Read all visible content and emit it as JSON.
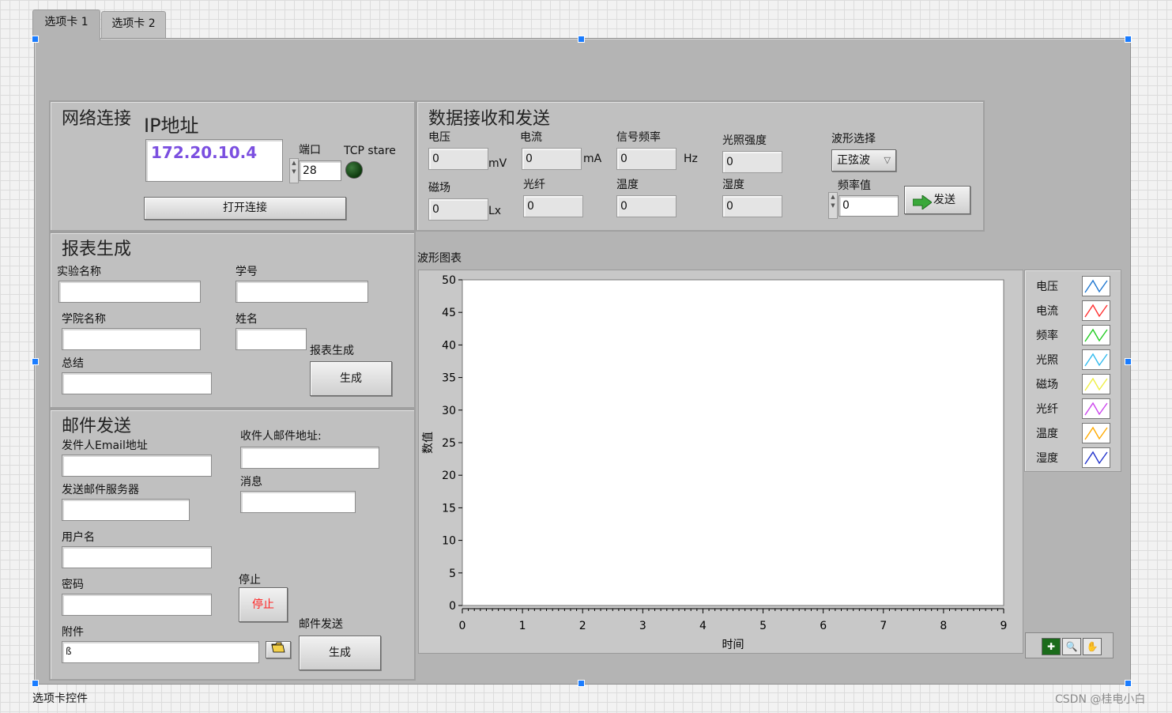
{
  "tabs": [
    {
      "label": "选项卡 1"
    },
    {
      "label": "选项卡 2"
    }
  ],
  "tab_control_label": "选项卡控件",
  "watermark": "CSDN @桂电小白",
  "network": {
    "title": "网络连接",
    "ip_label": "IP地址",
    "ip_value": "172.20.10.4",
    "port_label": "端口",
    "port_value": "28",
    "tcp_label": "TCP stare",
    "open_button": "打开连接"
  },
  "data_panel": {
    "title": "数据接收和发送",
    "voltage_label": "电压",
    "voltage_value": "0",
    "voltage_unit": "mV",
    "current_label": "电流",
    "current_value": "0",
    "current_unit": "mA",
    "freq_label": "信号频率",
    "freq_value": "0",
    "freq_unit": "Hz",
    "light_label": "光照强度",
    "light_value": "0",
    "wave_select_label": "波形选择",
    "wave_select_value": "正弦波",
    "magnet_label": "磁场",
    "magnet_value": "0",
    "magnet_unit": "Lx",
    "fiber_label": "光纤",
    "fiber_value": "0",
    "temp_label": "温度",
    "temp_value": "0",
    "humidity_label": "湿度",
    "humidity_value": "0",
    "freq_value_label": "频率值",
    "freq_input_value": "0",
    "send_button": "发送"
  },
  "report": {
    "title": "报表生成",
    "exp_name_label": "实验名称",
    "student_id_label": "学号",
    "college_label": "学院名称",
    "name_label": "姓名",
    "summary_label": "总结",
    "generate_label": "报表生成",
    "generate_button": "生成"
  },
  "mail": {
    "title": "邮件发送",
    "sender_label": "发件人Email地址",
    "receiver_label": "收件人邮件地址:",
    "server_label": "发送邮件服务器",
    "message_label": "消息",
    "username_label": "用户名",
    "password_label": "密码",
    "stop_label": "停止",
    "stop_button": "停止",
    "attachment_label": "附件",
    "attachment_path_icon": "ß",
    "send_label": "邮件发送",
    "send_button": "生成"
  },
  "chart_data": {
    "type": "line",
    "title": "波形图表",
    "xlabel": "时间",
    "ylabel": "数值",
    "xlim": [
      0,
      9
    ],
    "ylim": [
      0,
      50
    ],
    "x_ticks": [
      "0",
      "1",
      "2",
      "3",
      "4",
      "5",
      "6",
      "7",
      "8",
      "9"
    ],
    "y_ticks": [
      "0",
      "5",
      "10",
      "15",
      "20",
      "25",
      "30",
      "35",
      "40",
      "45",
      "50"
    ],
    "series": [
      {
        "name": "电压",
        "color": "#1f77d0",
        "values": []
      },
      {
        "name": "电流",
        "color": "#ff3030",
        "values": []
      },
      {
        "name": "频率",
        "color": "#22cc22",
        "values": []
      },
      {
        "name": "光照",
        "color": "#33bbee",
        "values": []
      },
      {
        "name": "磁场",
        "color": "#eeee44",
        "values": []
      },
      {
        "name": "光纤",
        "color": "#cc44ee",
        "values": []
      },
      {
        "name": "温度",
        "color": "#ffaa00",
        "values": []
      },
      {
        "name": "湿度",
        "color": "#2233cc",
        "values": []
      }
    ],
    "legend_position": "right"
  },
  "colors": {
    "panel": "#b4b4b4",
    "group": "#c0c0c0",
    "ip_text": "#7b4fe0",
    "stop_text": "#ff2020"
  }
}
